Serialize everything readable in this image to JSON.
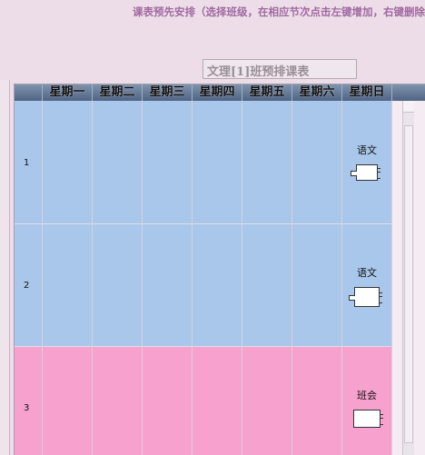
{
  "instruction": "课表预先安排（选择班级，在相应节次点击左键增加，右键删除",
  "table_title": "文理[1]班预排课表",
  "days": [
    "星期一",
    "星期二",
    "星期三",
    "星期四",
    "星期五",
    "星期六",
    "星期日"
  ],
  "periods": [
    {
      "number": "1",
      "color": "blue",
      "course": "语文"
    },
    {
      "number": "2",
      "color": "blue",
      "course": "语文"
    },
    {
      "number": "3",
      "color": "pink",
      "course": "班会"
    }
  ]
}
